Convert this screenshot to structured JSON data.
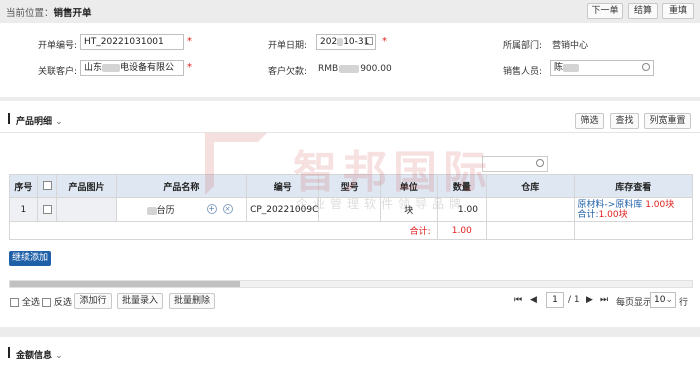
{
  "header": {
    "location_label": "当前位置：",
    "page_title": "销售开单",
    "buttons": [
      "下一单",
      "结算",
      "重填"
    ]
  },
  "form": {
    "order_no_label": "开单编号:",
    "order_no_value": "HT_20221031001",
    "order_date_label": "开单日期:",
    "order_date_value": "202",
    "order_date_suffix": "10-31",
    "dept_label": "所属部门:",
    "dept_value": "营销中心",
    "customer_label": "关联客户:",
    "customer_value": "山东",
    "customer_suffix": "电设备有限公",
    "debt_label": "客户欠款:",
    "debt_value": "RMB",
    "debt_suffix": "900.00",
    "sales_label": "销售人员:",
    "sales_value": "陈",
    "required_mark": "*"
  },
  "products": {
    "section_title": "产品明细",
    "toolbar": [
      "筛选",
      "查找",
      "列宽重置"
    ],
    "columns": [
      "序号",
      "",
      "产品图片",
      "产品名称",
      "编号",
      "型号",
      "单位",
      "数量",
      "仓库",
      "库存查看"
    ],
    "rows": [
      {
        "index": "1",
        "name": "台历",
        "code": "CP_20221009C",
        "model": "",
        "unit": "块",
        "qty": "1.00",
        "warehouse": "",
        "stock_line1_a": "原材料->原料库",
        "stock_line1_b": "1.00块",
        "stock_line2_a": "合计:",
        "stock_line2_b": "1.00块"
      }
    ],
    "total_label": "合计:",
    "total_value": "1.00",
    "continue_add": "继续添加",
    "footer_actions": [
      "全选",
      "反选",
      "添加行",
      "批量录入",
      "批量删除"
    ],
    "pager": {
      "current": "1",
      "total": "/ 1",
      "page_size_label": "每页显示",
      "page_size": "10",
      "unit": "行"
    }
  },
  "amount": {
    "section_title": "金额信息"
  },
  "watermark": {
    "main": "智邦国际",
    "sub": "企业管理软件领导品牌"
  }
}
